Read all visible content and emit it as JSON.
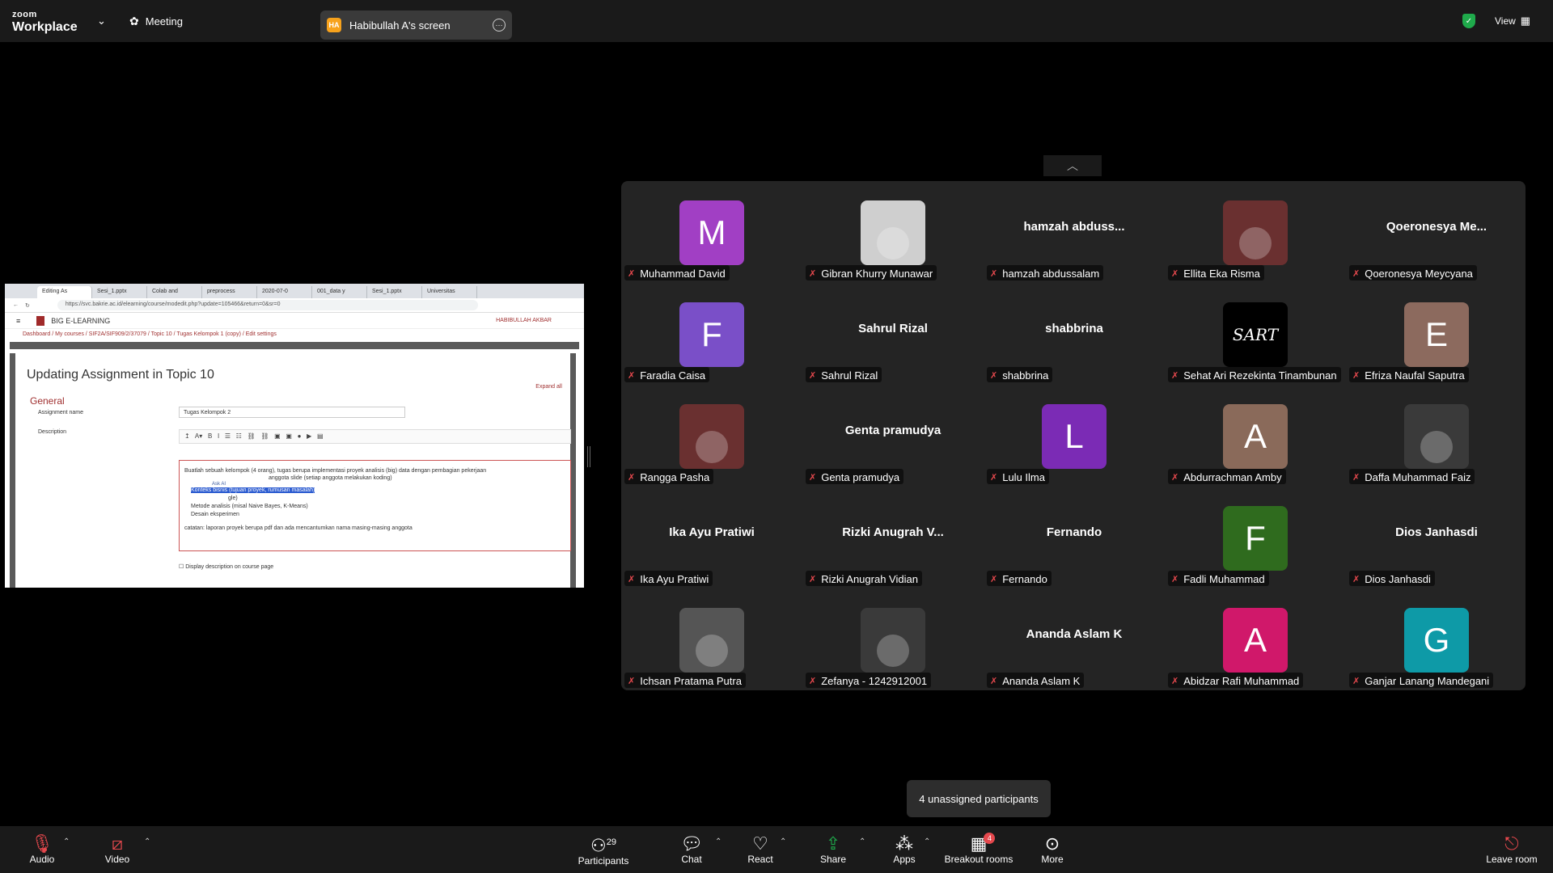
{
  "topbar": {
    "brand_top": "zoom",
    "brand_bottom": "Workplace",
    "meeting_label": "Meeting",
    "screen_initials": "HA",
    "screen_label": "Habibullah A's screen",
    "view_label": "View"
  },
  "shared_screen": {
    "tabs": [
      "Editing As",
      "Sesi_1.pptx",
      "Colab and",
      "preprocess",
      "2020-07-0",
      "001_data y",
      "Sesi_1.pptx",
      "Universitas"
    ],
    "url": "https://svc.bakrie.ac.id/elearning/course/modedit.php?update=105466&return=0&sr=0",
    "site_name": "BIG E-LEARNING",
    "user_name": "HABIBULLAH AKBAR",
    "breadcrumb": "Dashboard / My courses / SIF2A/SIF909/2/37079 / Topic 10 / Tugas Kelompok 1 (copy) / Edit settings",
    "heading": "Updating Assignment in Topic 10",
    "expand_all": "Expand all",
    "section": "General",
    "assignment_name_label": "Assignment name",
    "assignment_name_value": "Tugas Kelompok 2",
    "description_label": "Description",
    "editor_line1": "Buatlah sebuah kelompok (4 orang), tugas berupa implementasi proyek analisis (big) data dengan pembagian pekerjaan",
    "editor_line2": "anggota slide (setiap anggota melakukan koding)",
    "ask_ai": "Ask AI",
    "bullet1": "Konteks bisnis (tujuan proyek, rumusan masalah)",
    "bullet2": "gle)",
    "bullet3": "Metode analisis (misal Naive Bayes, K-Means)",
    "bullet4": "Desain eksperimen",
    "catatan": "catatan: laporan proyek berupa pdf dan ada mencantumkan nama masing-masing anggota",
    "display_desc": "Display description on course page"
  },
  "participants": [
    {
      "name": "Muhammad David",
      "letter": "M",
      "color": "#a13fc4"
    },
    {
      "name": "Gibran Khurry Munawar",
      "photo": "photo-avatar"
    },
    {
      "name": "hamzah abdussalam",
      "big": "hamzah  abduss..."
    },
    {
      "name": "Ellita Eka Risma",
      "photo": "photo-avatar"
    },
    {
      "name": "Qoeronesya Meycyana",
      "big": "Qoeronesya  Me..."
    },
    {
      "name": "Faradia Caisa",
      "letter": "F",
      "color": "#7a4fc8"
    },
    {
      "name": "Sahrul Rizal",
      "big": "Sahrul Rizal"
    },
    {
      "name": "shabbrina",
      "big": "shabbrina"
    },
    {
      "name": "Sehat Ari Rezekinta Tinambunan",
      "photo": "sart-logo",
      "logo_text": "SART"
    },
    {
      "name": "Efriza Naufal Saputra",
      "letter": "E",
      "color": "#8c6a5e"
    },
    {
      "name": "Rangga Pasha",
      "photo": "photo-avatar"
    },
    {
      "name": "Genta pramudya",
      "big": "Genta pramudya"
    },
    {
      "name": "Lulu Ilma",
      "letter": "L",
      "color": "#7b2bb5"
    },
    {
      "name": "Abdurrachman Amby",
      "letter": "A",
      "color": "#8a6a5a"
    },
    {
      "name": "Daffa Muhammad Faiz",
      "photo": "photo-avatar"
    },
    {
      "name": "Ika Ayu Pratiwi",
      "big": "Ika Ayu Pratiwi"
    },
    {
      "name": "Rizki Anugrah Vidian",
      "big": "Rizki  Anugrah  V..."
    },
    {
      "name": "Fernando",
      "big": "Fernando"
    },
    {
      "name": "Fadli Muhammad",
      "letter": "F",
      "color": "#2f6b1e"
    },
    {
      "name": "Dios Janhasdi",
      "big": "Dios Janhasdi"
    },
    {
      "name": "Ichsan Pratama Putra",
      "photo": "photo-avatar"
    },
    {
      "name": "Zefanya - 1242912001",
      "photo": "photo-avatar"
    },
    {
      "name": "Ananda Aslam K",
      "big": "Ananda Aslam K"
    },
    {
      "name": "Abidzar Rafi Muhammad",
      "letter": "A",
      "color": "#d0186a"
    },
    {
      "name": "Ganjar Lanang Mandegani",
      "letter": "G",
      "color": "#0e9aa7"
    }
  ],
  "unassigned_tooltip": "4 unassigned participants",
  "toolbar": {
    "audio": "Audio",
    "video": "Video",
    "participants": "Participants",
    "participants_count": "29",
    "chat": "Chat",
    "react": "React",
    "share": "Share",
    "apps": "Apps",
    "breakout": "Breakout rooms",
    "breakout_badge": "4",
    "more": "More",
    "leave": "Leave room"
  }
}
